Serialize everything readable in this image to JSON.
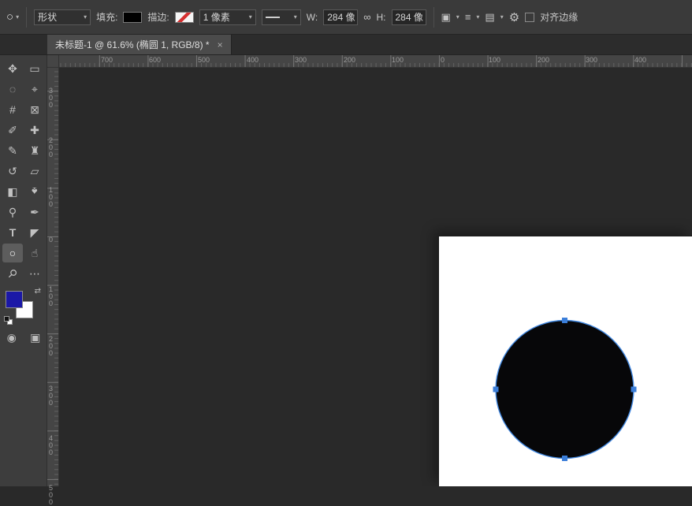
{
  "options_bar": {
    "tool_preset_icon": "○",
    "dropdown_arrow": "▾",
    "mode_value": "形状",
    "fill_label": "填充:",
    "stroke_label": "描边:",
    "stroke_width_value": "1 像素",
    "w_label": "W:",
    "w_value": "284 像",
    "link_icon": "∞",
    "h_label": "H:",
    "h_value": "284 像",
    "path_ops_icon": "▣",
    "path_align_icon": "≡",
    "path_arrange_icon": "▤",
    "gear_icon": "⚙",
    "align_edges_label": "对齐边缘"
  },
  "tab_bar": {
    "active_tab_title": "未标题-1 @ 61.6% (椭圆 1, RGB/8) *",
    "close_icon": "×"
  },
  "toolbar": {
    "tools": [
      {
        "name": "move-tool",
        "glyph": "✥"
      },
      {
        "name": "marquee-tool",
        "glyph": "▭"
      },
      {
        "name": "lasso-tool",
        "glyph": "◌"
      },
      {
        "name": "quick-selection-tool",
        "glyph": "⌖"
      },
      {
        "name": "crop-tool",
        "glyph": "#"
      },
      {
        "name": "frame-tool",
        "glyph": "⊠"
      },
      {
        "name": "eyedropper-tool",
        "glyph": "✐"
      },
      {
        "name": "healing-brush-tool",
        "glyph": "✚"
      },
      {
        "name": "brush-tool",
        "glyph": "✎"
      },
      {
        "name": "clone-stamp-tool",
        "glyph": "♜"
      },
      {
        "name": "history-brush-tool",
        "glyph": "↺"
      },
      {
        "name": "eraser-tool",
        "glyph": "▱"
      },
      {
        "name": "gradient-tool",
        "glyph": "◧"
      },
      {
        "name": "blur-tool",
        "glyph": "♠"
      },
      {
        "name": "dodge-tool",
        "glyph": "⚲"
      },
      {
        "name": "pen-tool",
        "glyph": "✒"
      },
      {
        "name": "type-tool",
        "glyph": "T"
      },
      {
        "name": "path-selection-tool",
        "glyph": "◤"
      },
      {
        "name": "ellipse-tool",
        "glyph": "○",
        "active": true
      },
      {
        "name": "hand-tool",
        "glyph": "☝"
      },
      {
        "name": "zoom-tool",
        "glyph": "⚲"
      },
      {
        "name": "edit-toolbar",
        "glyph": "⋯"
      }
    ],
    "swap_icon": "⇄",
    "foreground_color": "#1b18a7",
    "background_color": "#ffffff",
    "quick_mask_icon": "◉",
    "screen_mode_icon": "▣"
  },
  "rulers": {
    "horizontal_labels": [
      "700",
      "600",
      "500",
      "400",
      "300",
      "200",
      "100",
      "0",
      "100",
      "200",
      "300",
      "400"
    ],
    "vertical_labels": [
      "300",
      "200",
      "100",
      "0",
      "100",
      "200",
      "300",
      "400",
      "500"
    ]
  },
  "shape": {
    "fill_color": "#070709",
    "stroke_color": "#4288e0",
    "anchor_color": "#3b7ed9"
  }
}
